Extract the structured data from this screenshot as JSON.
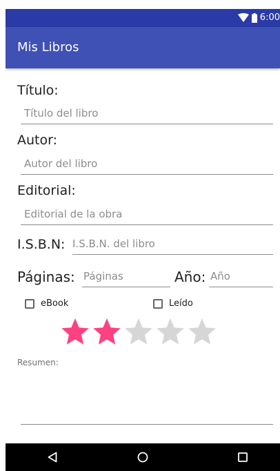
{
  "status_bar": {
    "time": "6:00"
  },
  "app_bar": {
    "title": "Mis Libros"
  },
  "form": {
    "titulo_label": "Título:",
    "titulo_placeholder": "Título del libro",
    "autor_label": "Autor:",
    "autor_placeholder": "Autor del libro",
    "editorial_label": "Editorial:",
    "editorial_placeholder": "Editorial de la obra",
    "isbn_label": "I.S.B.N:",
    "isbn_placeholder": "I.S.B.N. del libro",
    "paginas_label": "Páginas:",
    "paginas_placeholder": "Páginas",
    "anio_label": "Año:",
    "anio_placeholder": "Año",
    "ebook_label": "eBook",
    "ebook_checked": false,
    "leido_label": "Leído",
    "leido_checked": false,
    "rating": {
      "value": 2,
      "max": 5
    },
    "resumen_label": "Resumen:",
    "resumen_value": ""
  },
  "colors": {
    "status_bar": "#2a3aa6",
    "app_bar": "#3f51b5",
    "star_filled": "#ff4081",
    "star_empty": "#d6d6d6"
  },
  "nav_bar": {
    "buttons": [
      "back-icon",
      "home-icon",
      "recents-icon"
    ]
  }
}
